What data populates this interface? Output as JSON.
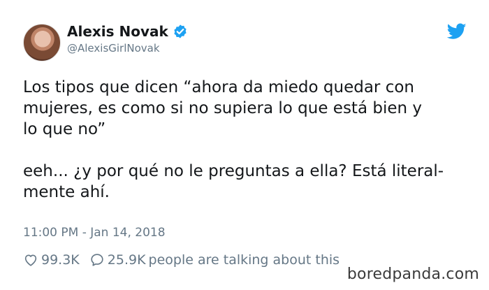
{
  "user": {
    "display_name": "Alexis Novak",
    "handle": "@AlexisGirlNovak",
    "verified": true
  },
  "tweet": {
    "paragraphs": [
      "Los tipos que dicen “ahora da miedo quedar con\nmujeres, es como si no supiera lo que está bien y\nlo que no”",
      "eeh... ¿y por qué no le preguntas a ella? Está literal-\nmente ahí."
    ],
    "timestamp": "11:00 PM - Jan 14, 2018"
  },
  "engagement": {
    "likes": "99.3K",
    "replies": "25.9K",
    "talking_label": "people are talking about this"
  },
  "watermark": "boredpanda.com",
  "colors": {
    "twitter_blue": "#1da1f2",
    "text": "#14171a",
    "muted": "#657786"
  },
  "icons": {
    "verified": "verified-badge-icon",
    "brand": "twitter-bird-icon",
    "like": "heart-icon",
    "reply": "speech-bubble-icon"
  }
}
